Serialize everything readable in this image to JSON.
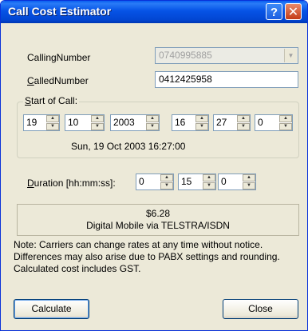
{
  "window": {
    "title": "Call Cost Estimator"
  },
  "titlebar": {
    "help_glyph": "?",
    "close_glyph": "✕"
  },
  "calling": {
    "label": "CallingNumber",
    "value": "0740995885"
  },
  "called": {
    "label_u": "C",
    "label_rest": "alledNumber",
    "value": "0412425958"
  },
  "start": {
    "legend_u": "S",
    "legend_rest": "tart of Call:",
    "day": "19",
    "month": "10",
    "year": "2003",
    "hour": "16",
    "minute": "27",
    "second": "0",
    "summary": "Sun, 19 Oct 2003 16:27:00"
  },
  "duration": {
    "label_u": "D",
    "label_rest": "uration [hh:mm:ss]:",
    "hh": "0",
    "mm": "15",
    "ss": "0"
  },
  "result": {
    "cost": "$6.28",
    "carrier": "Digital Mobile via TELSTRA/ISDN"
  },
  "note": {
    "text": "Note: Carriers can change rates at any time without notice. Differences may also arise due to PABX settings and rounding. Calculated cost includes GST."
  },
  "buttons": {
    "calculate": "Calculate",
    "close": "Close"
  },
  "icons": {
    "spin_up": "▲",
    "spin_down": "▼",
    "dropdown": "▼"
  }
}
